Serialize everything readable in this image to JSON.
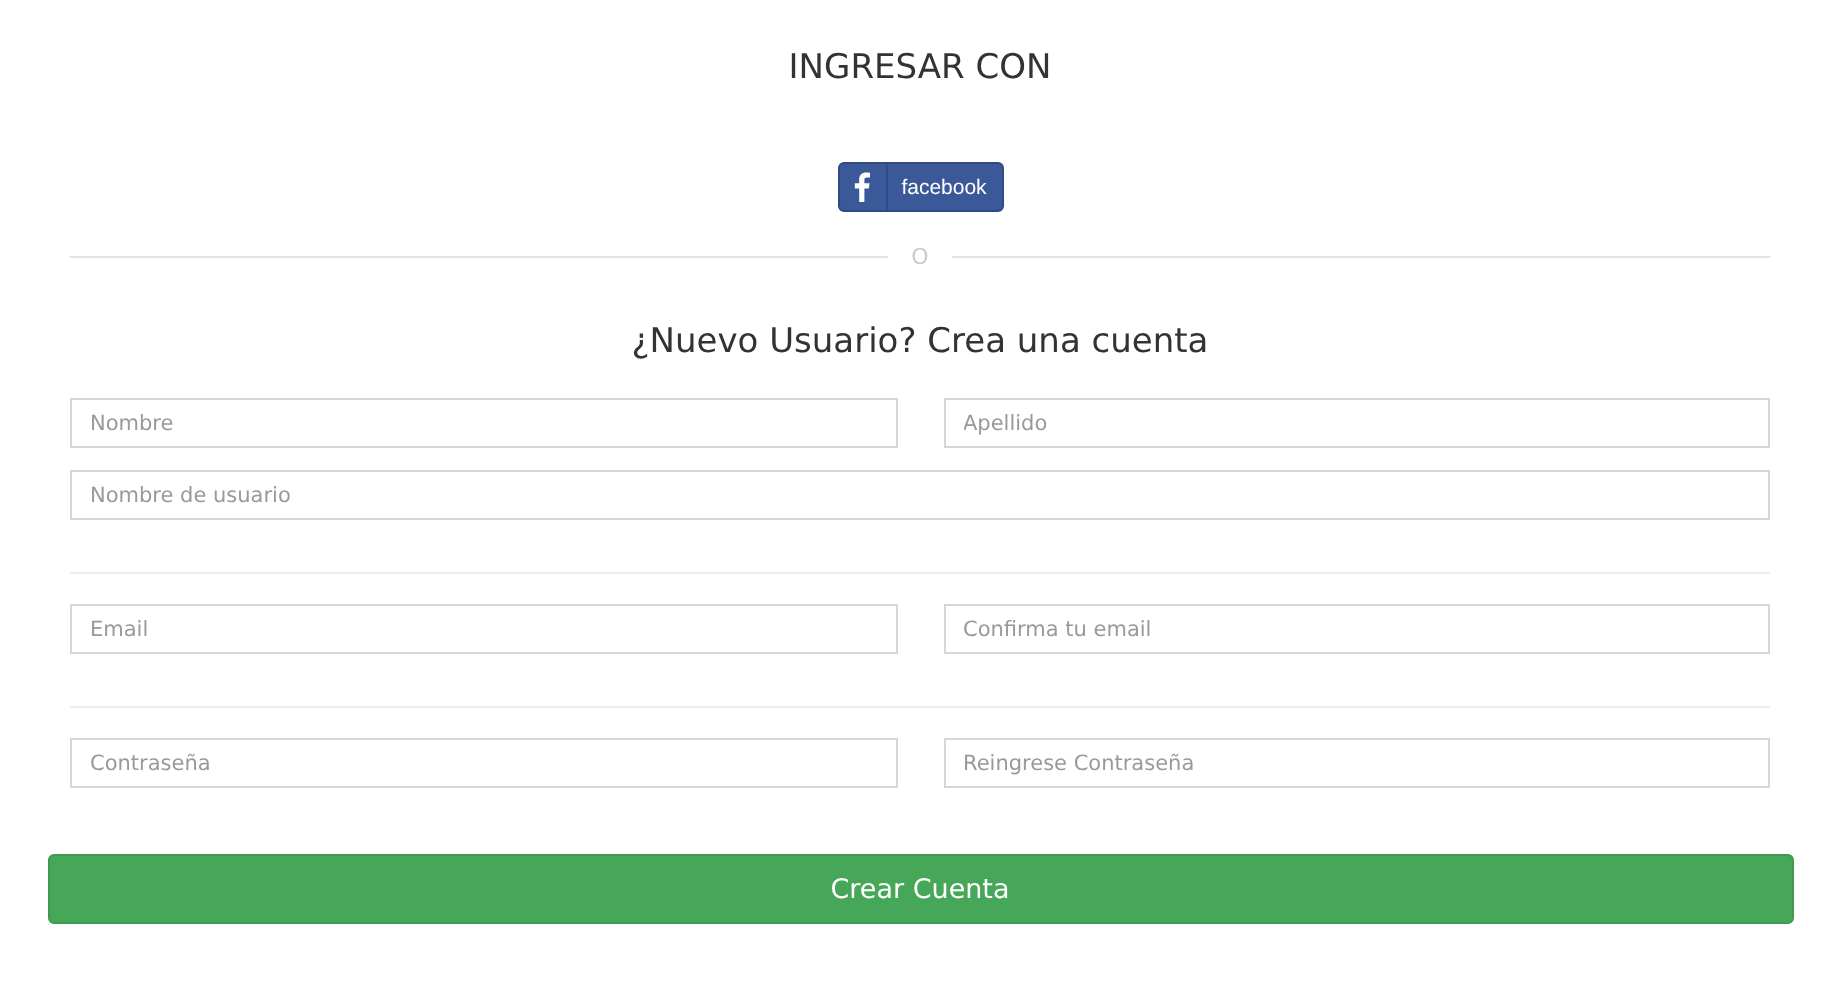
{
  "title": "INGRESAR CON",
  "social_button": {
    "label": "facebook"
  },
  "divider_text": "O",
  "heading": "¿Nuevo Usuario? Crea una cuenta",
  "sections": [
    {
      "rows": [
        [
          {
            "placeholder": "Nombre"
          },
          {
            "placeholder": "Apellido"
          }
        ],
        [
          {
            "placeholder": "Nombre de usuario"
          }
        ]
      ]
    },
    {
      "rows": [
        [
          {
            "placeholder": "Email"
          },
          {
            "placeholder": "Confirma tu email"
          }
        ]
      ]
    },
    {
      "rows": [
        [
          {
            "placeholder": "Contraseña"
          },
          {
            "placeholder": "Reingrese Contraseña"
          }
        ]
      ]
    }
  ],
  "submit_button": {
    "label": "Crear Cuenta"
  }
}
